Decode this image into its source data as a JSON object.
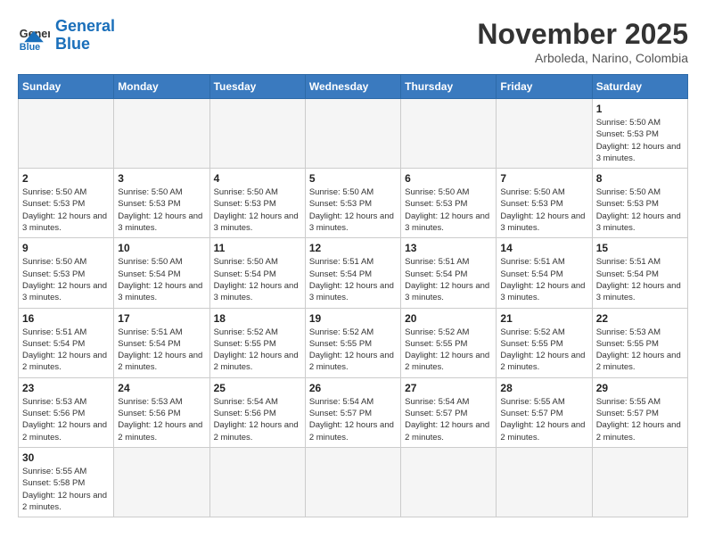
{
  "header": {
    "logo_general": "General",
    "logo_blue": "Blue",
    "month_title": "November 2025",
    "subtitle": "Arboleda, Narino, Colombia"
  },
  "days_of_week": [
    "Sunday",
    "Monday",
    "Tuesday",
    "Wednesday",
    "Thursday",
    "Friday",
    "Saturday"
  ],
  "weeks": [
    [
      {
        "day": "",
        "empty": true
      },
      {
        "day": "",
        "empty": true
      },
      {
        "day": "",
        "empty": true
      },
      {
        "day": "",
        "empty": true
      },
      {
        "day": "",
        "empty": true
      },
      {
        "day": "",
        "empty": true
      },
      {
        "day": "1",
        "sunrise": "5:50 AM",
        "sunset": "5:53 PM",
        "daylight": "12 hours and 3 minutes."
      }
    ],
    [
      {
        "day": "2",
        "sunrise": "5:50 AM",
        "sunset": "5:53 PM",
        "daylight": "12 hours and 3 minutes."
      },
      {
        "day": "3",
        "sunrise": "5:50 AM",
        "sunset": "5:53 PM",
        "daylight": "12 hours and 3 minutes."
      },
      {
        "day": "4",
        "sunrise": "5:50 AM",
        "sunset": "5:53 PM",
        "daylight": "12 hours and 3 minutes."
      },
      {
        "day": "5",
        "sunrise": "5:50 AM",
        "sunset": "5:53 PM",
        "daylight": "12 hours and 3 minutes."
      },
      {
        "day": "6",
        "sunrise": "5:50 AM",
        "sunset": "5:53 PM",
        "daylight": "12 hours and 3 minutes."
      },
      {
        "day": "7",
        "sunrise": "5:50 AM",
        "sunset": "5:53 PM",
        "daylight": "12 hours and 3 minutes."
      },
      {
        "day": "8",
        "sunrise": "5:50 AM",
        "sunset": "5:53 PM",
        "daylight": "12 hours and 3 minutes."
      }
    ],
    [
      {
        "day": "9",
        "sunrise": "5:50 AM",
        "sunset": "5:53 PM",
        "daylight": "12 hours and 3 minutes."
      },
      {
        "day": "10",
        "sunrise": "5:50 AM",
        "sunset": "5:54 PM",
        "daylight": "12 hours and 3 minutes."
      },
      {
        "day": "11",
        "sunrise": "5:50 AM",
        "sunset": "5:54 PM",
        "daylight": "12 hours and 3 minutes."
      },
      {
        "day": "12",
        "sunrise": "5:51 AM",
        "sunset": "5:54 PM",
        "daylight": "12 hours and 3 minutes."
      },
      {
        "day": "13",
        "sunrise": "5:51 AM",
        "sunset": "5:54 PM",
        "daylight": "12 hours and 3 minutes."
      },
      {
        "day": "14",
        "sunrise": "5:51 AM",
        "sunset": "5:54 PM",
        "daylight": "12 hours and 3 minutes."
      },
      {
        "day": "15",
        "sunrise": "5:51 AM",
        "sunset": "5:54 PM",
        "daylight": "12 hours and 3 minutes."
      }
    ],
    [
      {
        "day": "16",
        "sunrise": "5:51 AM",
        "sunset": "5:54 PM",
        "daylight": "12 hours and 2 minutes."
      },
      {
        "day": "17",
        "sunrise": "5:51 AM",
        "sunset": "5:54 PM",
        "daylight": "12 hours and 2 minutes."
      },
      {
        "day": "18",
        "sunrise": "5:52 AM",
        "sunset": "5:55 PM",
        "daylight": "12 hours and 2 minutes."
      },
      {
        "day": "19",
        "sunrise": "5:52 AM",
        "sunset": "5:55 PM",
        "daylight": "12 hours and 2 minutes."
      },
      {
        "day": "20",
        "sunrise": "5:52 AM",
        "sunset": "5:55 PM",
        "daylight": "12 hours and 2 minutes."
      },
      {
        "day": "21",
        "sunrise": "5:52 AM",
        "sunset": "5:55 PM",
        "daylight": "12 hours and 2 minutes."
      },
      {
        "day": "22",
        "sunrise": "5:53 AM",
        "sunset": "5:55 PM",
        "daylight": "12 hours and 2 minutes."
      }
    ],
    [
      {
        "day": "23",
        "sunrise": "5:53 AM",
        "sunset": "5:56 PM",
        "daylight": "12 hours and 2 minutes."
      },
      {
        "day": "24",
        "sunrise": "5:53 AM",
        "sunset": "5:56 PM",
        "daylight": "12 hours and 2 minutes."
      },
      {
        "day": "25",
        "sunrise": "5:54 AM",
        "sunset": "5:56 PM",
        "daylight": "12 hours and 2 minutes."
      },
      {
        "day": "26",
        "sunrise": "5:54 AM",
        "sunset": "5:57 PM",
        "daylight": "12 hours and 2 minutes."
      },
      {
        "day": "27",
        "sunrise": "5:54 AM",
        "sunset": "5:57 PM",
        "daylight": "12 hours and 2 minutes."
      },
      {
        "day": "28",
        "sunrise": "5:55 AM",
        "sunset": "5:57 PM",
        "daylight": "12 hours and 2 minutes."
      },
      {
        "day": "29",
        "sunrise": "5:55 AM",
        "sunset": "5:57 PM",
        "daylight": "12 hours and 2 minutes."
      }
    ],
    [
      {
        "day": "30",
        "sunrise": "5:55 AM",
        "sunset": "5:58 PM",
        "daylight": "12 hours and 2 minutes."
      },
      {
        "day": "",
        "empty": true
      },
      {
        "day": "",
        "empty": true
      },
      {
        "day": "",
        "empty": true
      },
      {
        "day": "",
        "empty": true
      },
      {
        "day": "",
        "empty": true
      },
      {
        "day": "",
        "empty": true
      }
    ]
  ]
}
